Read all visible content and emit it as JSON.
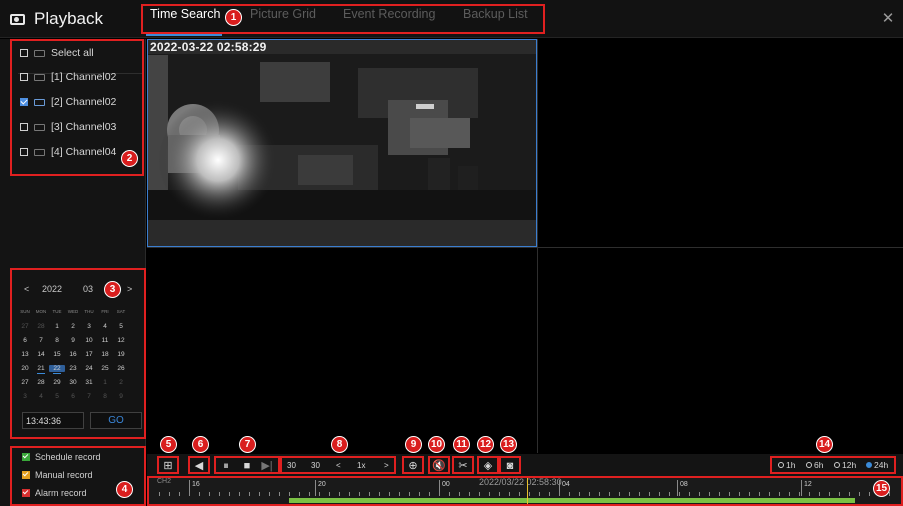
{
  "header": {
    "title": "Playback",
    "tabs": [
      {
        "label": "Time Search",
        "active": true
      },
      {
        "label": "Picture Grid",
        "active": false
      },
      {
        "label": "Event Recording",
        "active": false
      },
      {
        "label": "Backup List",
        "active": false
      }
    ],
    "close_icon": "close-icon"
  },
  "channels": {
    "select_all_label": "Select all",
    "items": [
      {
        "label": "[1] Channel02",
        "checked": false
      },
      {
        "label": "[2] Channel02",
        "checked": true
      },
      {
        "label": "[3] Channel03",
        "checked": false
      },
      {
        "label": "[4] Channel04",
        "checked": false
      }
    ]
  },
  "calendar": {
    "prev": "<",
    "next": ">",
    "year": "2022",
    "month": "03",
    "weekdays": [
      "SUN",
      "MON",
      "TUE",
      "WED",
      "THU",
      "FRI",
      "SAT"
    ],
    "days": [
      [
        "27",
        "28",
        "1",
        "2",
        "3",
        "4",
        "5"
      ],
      [
        "6",
        "7",
        "8",
        "9",
        "10",
        "11",
        "12"
      ],
      [
        "13",
        "14",
        "15",
        "16",
        "17",
        "18",
        "19"
      ],
      [
        "20",
        "21",
        "22",
        "23",
        "24",
        "25",
        "26"
      ],
      [
        "27",
        "28",
        "29",
        "30",
        "31",
        "1",
        "2"
      ],
      [
        "3",
        "4",
        "5",
        "6",
        "7",
        "8",
        "9"
      ]
    ],
    "selected_day": "22",
    "time_value": "13:43:36",
    "go_label": "GO"
  },
  "record_types": [
    {
      "label": "Schedule record",
      "color": "#3aa83a"
    },
    {
      "label": "Manual record",
      "color": "#e6a020"
    },
    {
      "label": "Alarm record",
      "color": "#d83030"
    }
  ],
  "video": {
    "osd_timestamp": "2022-03-22 02:58:29"
  },
  "controls": {
    "speed_back": "30",
    "speed_fwd": "30",
    "speed_prev": "<",
    "speed_value": "1x",
    "speed_next": ">",
    "zoom_options": [
      "1h",
      "6h",
      "12h",
      "24h"
    ],
    "zoom_selected": "24h"
  },
  "timeline": {
    "channel_label": "CH2",
    "current_time": "2022/03/22 02:58:30",
    "hour_labels": [
      "16",
      "20",
      "00",
      "04",
      "08",
      "12"
    ],
    "accent": "#7ac143"
  },
  "badges": [
    "1",
    "2",
    "3",
    "4",
    "5",
    "6",
    "7",
    "8",
    "9",
    "10",
    "11",
    "12",
    "13",
    "14",
    "15"
  ]
}
